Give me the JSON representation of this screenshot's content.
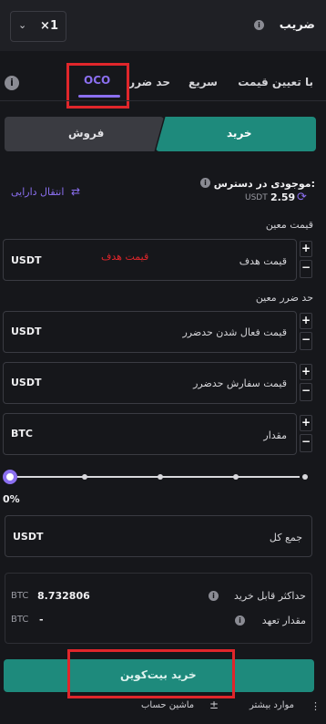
{
  "header": {
    "leverage_label": "ضریب",
    "leverage_value": "×1",
    "info_icon": "info-icon",
    "chevron_icon": "chevron-down-icon"
  },
  "tabs": {
    "items": [
      {
        "label": "با تعیین قیمت"
      },
      {
        "label": "سریع"
      },
      {
        "label": "حد ضرر"
      },
      {
        "label": "OCO"
      }
    ],
    "active": "OCO"
  },
  "side": {
    "buy_label": "خرید",
    "sell_label": "فروش"
  },
  "balance": {
    "label": "موجودی در دسترس:",
    "amount": "2.59",
    "unit": "USDT",
    "transfer_label": "انتقال دارایی"
  },
  "sections": {
    "price_section": "قیمت معین",
    "stop_section": "حد ضرر معین"
  },
  "fields": {
    "target_price_label": "قیمت هدف",
    "target_price_annotation": "قیمت هدف",
    "target_price_unit": "USDT",
    "stop_trigger_label": "قیمت فعال شدن حدضرر",
    "stop_trigger_unit": "USDT",
    "stop_order_label": "قیمت سفارش حدضرر",
    "stop_order_unit": "USDT",
    "amount_label": "مقدار",
    "amount_unit": "BTC",
    "total_label": "جمع کل",
    "total_unit": "USDT"
  },
  "slider": {
    "percent": "0%",
    "value": 0
  },
  "summary": {
    "max_buy_label": "حداکثر قابل خرید",
    "max_buy_value": "8.732806",
    "max_buy_unit": "BTC",
    "commitment_label": "مقدار تعهد",
    "commitment_value": "-",
    "commitment_unit": "BTC"
  },
  "actions": {
    "submit_label": "خرید بیت‌کوین",
    "more_label": "موارد بیشتر",
    "calculator_label": "ماشین حساب"
  },
  "colors": {
    "accent": "#1e8a7c",
    "active_tab": "#8b6ff0",
    "highlight_box": "#e0262b",
    "link": "#8b6ff0"
  }
}
